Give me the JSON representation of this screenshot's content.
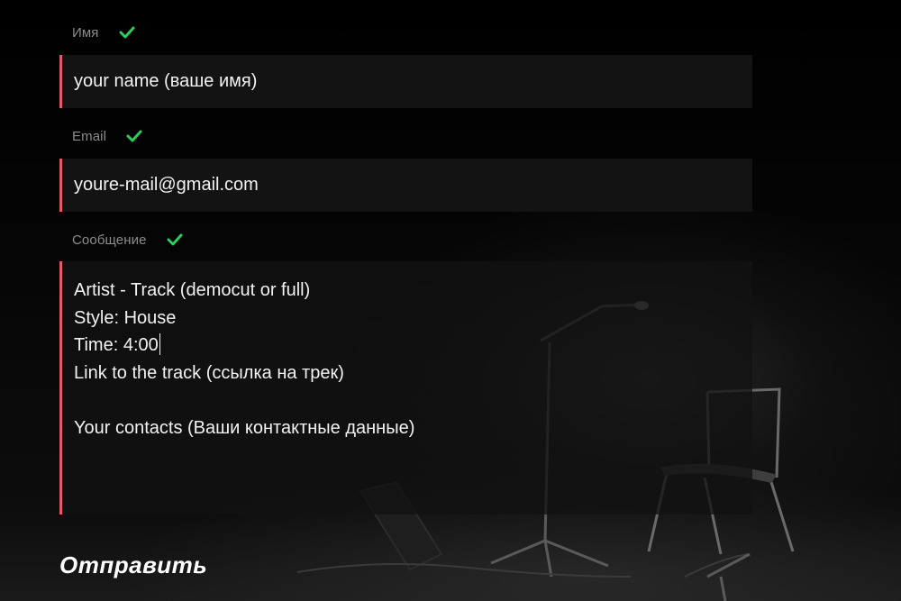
{
  "colors": {
    "accent_border": "#e45a6a",
    "check": "#2ecc5c",
    "label": "#8c8c8c",
    "text": "#f2f2f2",
    "field_bg": "#161616"
  },
  "form": {
    "name": {
      "label": "Имя",
      "value": "your name (ваше имя)",
      "status_icon": "check-icon"
    },
    "email": {
      "label": "Email",
      "value": "youre-mail@gmail.com",
      "status_icon": "check-icon"
    },
    "message": {
      "label": "Сообщение",
      "status_icon": "check-icon",
      "lines": [
        "Artist - Track (democut or full)",
        "Style: House",
        "Time: 4:00",
        "Link to the track (ссылка на трек)",
        "",
        "Your contacts (Ваши контактные данные)"
      ]
    },
    "submit_label": "Отправить"
  }
}
